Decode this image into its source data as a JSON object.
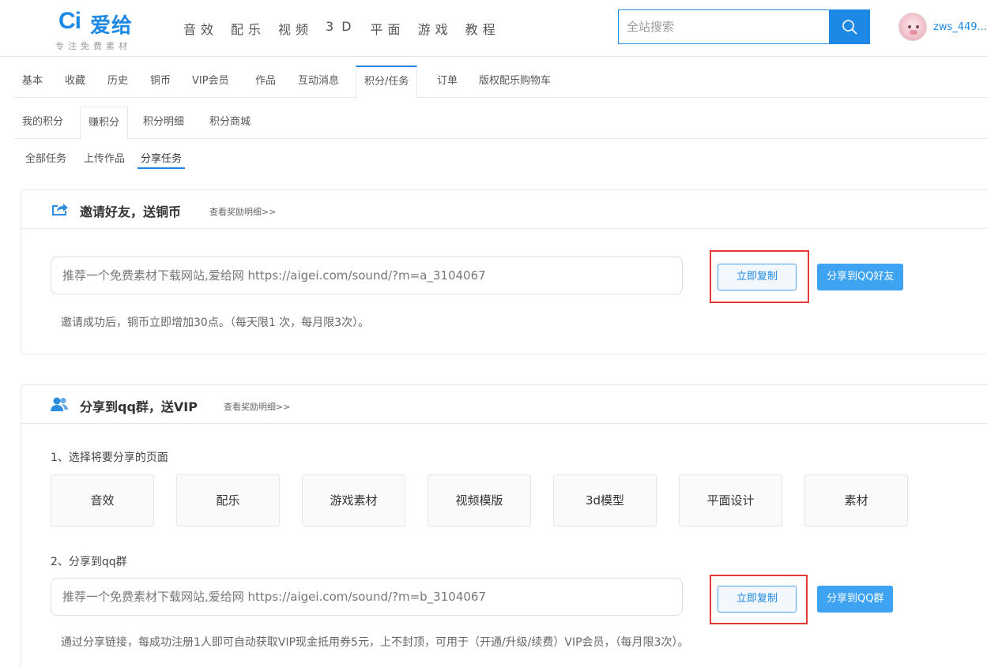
{
  "header": {
    "logo_mark": "Ci",
    "logo_name": "爱给",
    "logo_tagline": "专注免费素材",
    "nav": [
      "音效",
      "配乐",
      "视频",
      "3D",
      "平面",
      "游戏",
      "教程"
    ],
    "search_placeholder": "全站搜索",
    "username": "zws_449..."
  },
  "tabs_main": [
    "基本",
    "收藏",
    "历史",
    "铜币",
    "VIP会员",
    "作品",
    "互动消息",
    "积分/任务",
    "订单",
    "版权配乐购物车"
  ],
  "tabs_main_active": "积分/任务",
  "tabs_sub": [
    "我的积分",
    "赚积分",
    "积分明细",
    "积分商城"
  ],
  "tabs_sub_active": "赚积分",
  "tabs_task": [
    "全部任务",
    "上传作品",
    "分享任务"
  ],
  "tabs_task_active": "分享任务",
  "invite": {
    "title": "邀请好友，送铜币",
    "detail_link": "查看奖励明细>>",
    "share_text": "推荐一个免费素材下载网站,爱给网   https://aigei.com/sound/?m=a_3104067",
    "copy_button": "立即复制",
    "share_button": "分享到QQ好友",
    "note": "邀请成功后，铜币立即增加30点。（每天限1 次，每月限3次）。"
  },
  "qq_group": {
    "title": "分享到qq群，送VIP",
    "detail_link": "查看奖励明细>>",
    "step1": "1、选择将要分享的页面",
    "categories": [
      "音效",
      "配乐",
      "游戏素材",
      "视频模版",
      "3d模型",
      "平面设计",
      "素材"
    ],
    "step2": "2、分享到qq群",
    "share_text": "推荐一个免费素材下载网站,爱给网   https://aigei.com/sound/?m=b_3104067",
    "copy_button": "立即复制",
    "share_button": "分享到QQ群",
    "note": "通过分享链接，每成功注册1人即可自动获取VIP现金抵用券5元，上不封顶，可用于（开通/升级/续费）VIP会员，（每月限3次）。"
  },
  "colors": {
    "accent": "#1e88e5",
    "share_button": "#3ea3f2",
    "highlight_box": "#e53935"
  }
}
